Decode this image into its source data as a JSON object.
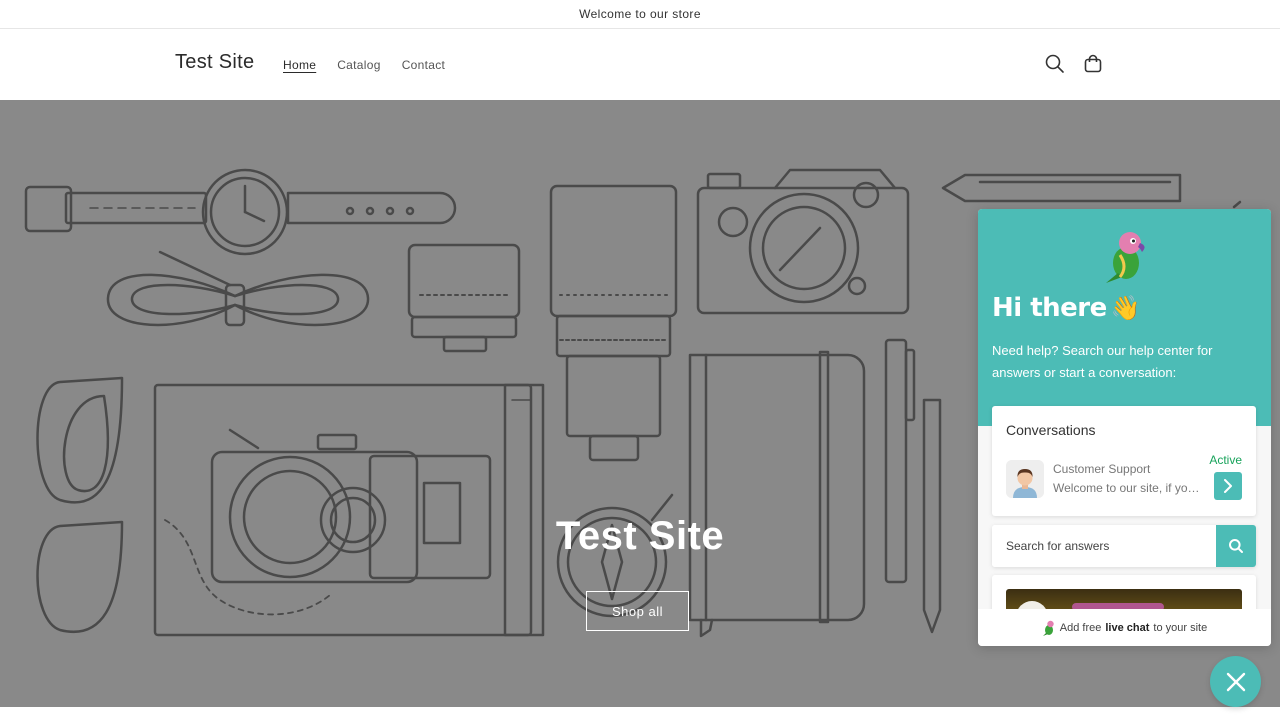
{
  "announcement": {
    "text": "Welcome to our store"
  },
  "header": {
    "logo": "Test Site",
    "nav": [
      {
        "label": "Home",
        "active": true
      },
      {
        "label": "Catalog",
        "active": false
      },
      {
        "label": "Contact",
        "active": false
      }
    ],
    "icons": [
      "search-icon",
      "cart-icon"
    ]
  },
  "hero": {
    "title": "Test Site",
    "button_label": "Shop all",
    "background_color": "#898989"
  },
  "chat_widget": {
    "accent_color": "#4cbcb6",
    "greeting": "Hi there",
    "greeting_emoji": "👋",
    "subtitle": "Need help? Search our help center for answers or start a conversation:",
    "conversations": {
      "title": "Conversations",
      "item": {
        "name": "Customer Support",
        "message": "Welcome to our site, if you need help simply reply to this message",
        "status": "Active",
        "status_color": "#18a35b"
      }
    },
    "search": {
      "placeholder": "Search for answers"
    },
    "footer": {
      "prefix": "Add free",
      "bold": "live chat",
      "suffix": "to your site"
    }
  }
}
